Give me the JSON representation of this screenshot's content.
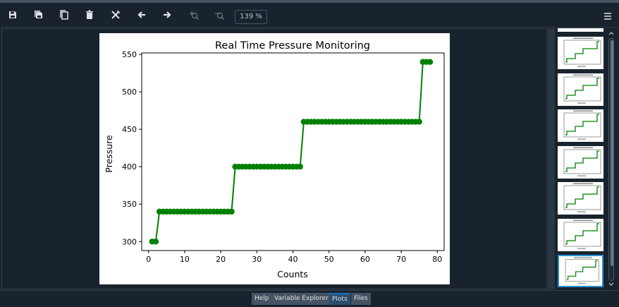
{
  "toolbar": {
    "buttons": [
      {
        "name": "save-icon"
      },
      {
        "name": "save-all-icon"
      },
      {
        "name": "copy-icon"
      },
      {
        "name": "delete-icon"
      },
      {
        "name": "delete-all-icon"
      },
      {
        "name": "arrow-left-icon"
      },
      {
        "name": "arrow-right-icon"
      },
      {
        "name": "zoom-in-icon"
      },
      {
        "name": "zoom-out-icon"
      }
    ],
    "zoom": "139 %",
    "menu_icon": "hamburger-menu-icon"
  },
  "colors": {
    "background": "#19232d",
    "series": "#008000",
    "tab_active": "#2b4e6e",
    "selection": "#2a8fd1"
  },
  "chart_data": {
    "type": "line",
    "title": "Real Time Pressure Monitoring",
    "xlabel": "Counts",
    "ylabel": "Pressure",
    "xlim": [
      -1.9,
      81.9
    ],
    "ylim": [
      288,
      552
    ],
    "xticks": [
      0,
      10,
      20,
      30,
      40,
      50,
      60,
      70,
      80
    ],
    "yticks": [
      300,
      350,
      400,
      450,
      500,
      550
    ],
    "grid": false,
    "series": [
      {
        "marker": "circle",
        "color": "#008000",
        "x": [
          1,
          2,
          3,
          4,
          5,
          6,
          7,
          8,
          9,
          10,
          11,
          12,
          13,
          14,
          15,
          16,
          17,
          18,
          19,
          20,
          21,
          22,
          23,
          24,
          25,
          26,
          27,
          28,
          29,
          30,
          31,
          32,
          33,
          34,
          35,
          36,
          37,
          38,
          39,
          40,
          41,
          42,
          43,
          44,
          45,
          46,
          47,
          48,
          49,
          50,
          51,
          52,
          53,
          54,
          55,
          56,
          57,
          58,
          59,
          60,
          61,
          62,
          63,
          64,
          65,
          66,
          67,
          68,
          69,
          70,
          71,
          72,
          73,
          74,
          75,
          76,
          77,
          78
        ],
        "y": [
          300,
          300,
          340,
          340,
          340,
          340,
          340,
          340,
          340,
          340,
          340,
          340,
          340,
          340,
          340,
          340,
          340,
          340,
          340,
          340,
          340,
          340,
          340,
          400,
          400,
          400,
          400,
          400,
          400,
          400,
          400,
          400,
          400,
          400,
          400,
          400,
          400,
          400,
          400,
          400,
          400,
          400,
          460,
          460,
          460,
          460,
          460,
          460,
          460,
          460,
          460,
          460,
          460,
          460,
          460,
          460,
          460,
          460,
          460,
          460,
          460,
          460,
          460,
          460,
          460,
          460,
          460,
          460,
          460,
          460,
          460,
          460,
          460,
          460,
          460,
          540,
          540,
          540
        ]
      }
    ]
  },
  "thumbnails": {
    "count": 7,
    "selected_index": 6
  },
  "tabs": [
    {
      "label": "Help"
    },
    {
      "label": "Variable Explorer"
    },
    {
      "label": "Plots"
    },
    {
      "label": "Files"
    }
  ]
}
